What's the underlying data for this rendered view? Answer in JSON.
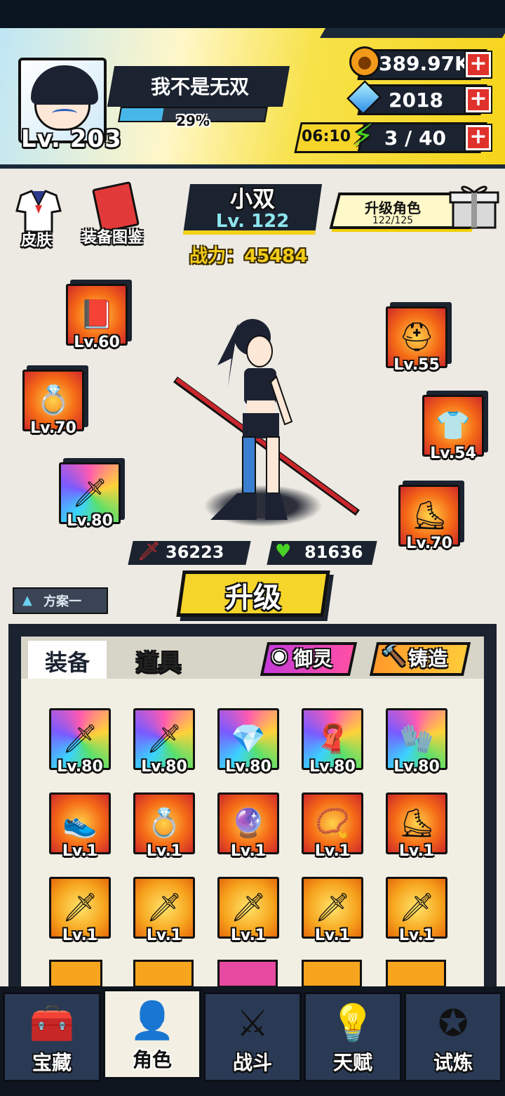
{
  "player": {
    "name": "我不是无双",
    "level_text": "Lv. 203",
    "exp_text": "29%",
    "exp_fraction": 0.29
  },
  "resources": {
    "paw": {
      "value": "389.97K",
      "icon": "paw-coin-icon"
    },
    "gem": {
      "value": "2018",
      "icon": "diamond-icon"
    },
    "energy": {
      "timer": "06:10",
      "value": "3 / 40",
      "icon": "lightning-icon"
    },
    "plus": "+"
  },
  "side": {
    "skin_label": "皮肤",
    "catalog_label": "装备图鉴"
  },
  "hero": {
    "name": "小双",
    "level_text": "Lv. 122",
    "power_text": "战力：45484"
  },
  "upgrade_character": {
    "label": "升级角色",
    "progress_text": "122/125"
  },
  "equipped": {
    "left": [
      {
        "level": "Lv.60",
        "icon": "passport-book-icon"
      },
      {
        "level": "Lv.70",
        "icon": "ring-icon"
      },
      {
        "level": "Lv.80",
        "icon": "blade-icon"
      }
    ],
    "right": [
      {
        "level": "Lv.55",
        "icon": "helmet-icon"
      },
      {
        "level": "Lv.54",
        "icon": "sailor-shirt-icon"
      },
      {
        "level": "Lv.70",
        "icon": "roller-skate-icon"
      }
    ]
  },
  "stats": {
    "attack": "36223",
    "hp": "81636"
  },
  "scheme_label": "方案一",
  "upgrade_button": "升级",
  "tabs": {
    "equipment": "装备",
    "items": "道具"
  },
  "actions": {
    "yuling": "御灵",
    "zhuzao": "铸造"
  },
  "inventory": [
    [
      {
        "level": "Lv.80",
        "icon": "dark-blade-icon"
      },
      {
        "level": "Lv.80",
        "icon": "banana-blade-icon"
      },
      {
        "level": "Lv.80",
        "icon": "pendant-icon"
      },
      {
        "level": "Lv.80",
        "icon": "scarf-icon"
      },
      {
        "level": "Lv.80",
        "icon": "glove-icon"
      }
    ],
    [
      {
        "level": "Lv.1",
        "icon": "blue-shoe-icon"
      },
      {
        "level": "Lv.1",
        "icon": "ring-icon"
      },
      {
        "level": "Lv.1",
        "icon": "orb-icon"
      },
      {
        "level": "Lv.1",
        "icon": "necklace-icon"
      },
      {
        "level": "Lv.1",
        "icon": "roller-skate-icon"
      }
    ],
    [
      {
        "level": "Lv.1",
        "icon": "katana-icon"
      },
      {
        "level": "Lv.1",
        "icon": "red-blade-icon"
      },
      {
        "level": "Lv.1",
        "icon": "dark-blade-icon"
      },
      {
        "level": "Lv.1",
        "icon": "dark-blade-icon"
      },
      {
        "level": "Lv.1",
        "icon": "banana-blade-icon"
      }
    ]
  ],
  "nav": [
    {
      "label": "宝藏",
      "icon": "treasure-chest-icon",
      "active": false
    },
    {
      "label": "角色",
      "icon": "character-icon",
      "active": true
    },
    {
      "label": "战斗",
      "icon": "battle-swords-icon",
      "active": false
    },
    {
      "label": "天赋",
      "icon": "lightbulb-icon",
      "active": false
    },
    {
      "label": "试炼",
      "icon": "trial-emblem-icon",
      "active": false
    }
  ],
  "colors": {
    "accent_yellow": "#f6d52a",
    "dark_panel": "#1b2330",
    "exp_blue": "#47b6e8",
    "plus_red": "#e0322c"
  }
}
